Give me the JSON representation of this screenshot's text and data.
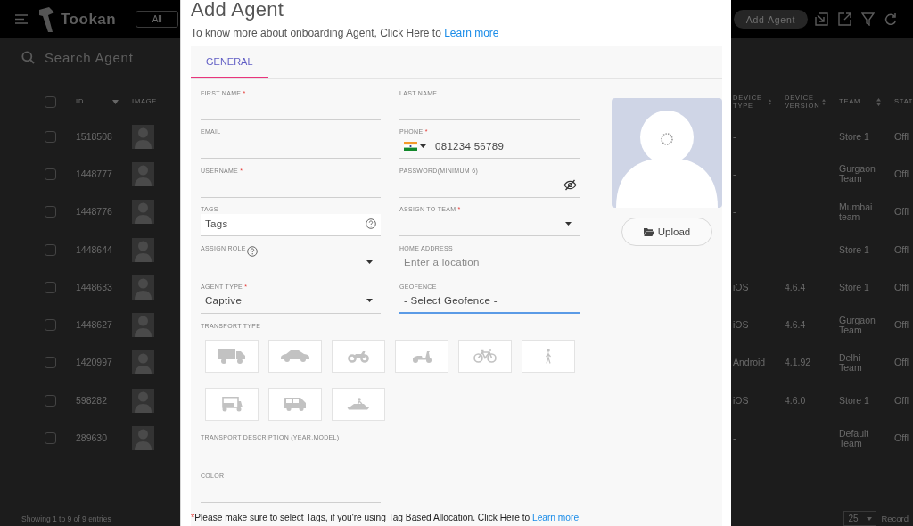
{
  "header": {
    "logo": "Tookan",
    "filter": "All",
    "add_button": "Add Agent"
  },
  "search": {
    "placeholder": "Search Agent"
  },
  "table": {
    "select_all": {
      "checked": false
    },
    "columns": [
      {
        "label": "ID",
        "sortable": true,
        "sorted": true
      },
      {
        "label": "IMAGE",
        "sortable": false
      },
      {
        "label": "DEVICE TYPE",
        "sortable": true,
        "sorted": false
      },
      {
        "label": "DEVICE VERSION",
        "sortable": true,
        "sorted": false
      },
      {
        "label": "TEAM",
        "sortable": true,
        "sorted": false
      },
      {
        "label": "STAT",
        "sortable": false
      }
    ],
    "rows": [
      {
        "checked": false,
        "id": "1518508",
        "device_type": "-",
        "team": "Store 1",
        "status": "Offl"
      },
      {
        "checked": false,
        "id": "1448777",
        "device_type": "-",
        "team": "Gurgaon Team",
        "status": "Offl"
      },
      {
        "checked": false,
        "id": "1448776",
        "device_type": "-",
        "team": "Mumbai team",
        "status": "Offl"
      },
      {
        "checked": false,
        "id": "1448644",
        "device_type": "-",
        "team": "Store 1",
        "status": "Offl"
      },
      {
        "checked": false,
        "id": "1448633",
        "device_type": "iOS",
        "device_version": "4.6.4",
        "team": "Store 1",
        "status": "Offl"
      },
      {
        "checked": false,
        "id": "1448627",
        "device_type": "iOS",
        "device_version": "4.6.4",
        "team": "Gurgaon Team",
        "status": "Offl"
      },
      {
        "checked": false,
        "id": "1420997",
        "device_type": "Android",
        "device_version": "4.1.92",
        "team": "Delhi Team",
        "status": "Offl"
      },
      {
        "checked": false,
        "id": "598282",
        "device_type": "iOS",
        "device_version": "4.6.0",
        "team": "Store 1",
        "status": "Offl"
      },
      {
        "checked": false,
        "id": "289630",
        "device_type": "-",
        "team": "Default Team",
        "status": "Offl"
      }
    ]
  },
  "footer": {
    "info": "Showing 1 to 9 of 9 entries",
    "page_size": "25",
    "page_size_label": "Record"
  },
  "modal": {
    "title": "Add Agent",
    "intro": {
      "text": "To know more about onboarding Agent, Click Here to",
      "link": "Learn more"
    },
    "tabs": [
      {
        "label": "GENERAL",
        "selected": true
      }
    ],
    "fields": [
      {
        "kind": "text",
        "label": "FIRST NAME",
        "marker": "*",
        "help": false,
        "focused": false
      },
      {
        "kind": "text",
        "label": "LAST NAME",
        "help": false,
        "focused": false
      },
      {
        "kind": "text",
        "label": "EMAIL",
        "help": false,
        "focused": false
      },
      {
        "kind": "phone",
        "label": "PHONE",
        "marker": "*",
        "help": false,
        "focused": false,
        "value": "081234 56789"
      },
      {
        "kind": "text",
        "label": "USERNAME",
        "marker": "*",
        "help": false,
        "focused": false
      },
      {
        "kind": "password",
        "label": "PASSWORD(MINIMUM 6)",
        "help": false,
        "focused": false
      },
      {
        "kind": "tags",
        "label": "TAGS",
        "help": false,
        "focused": false,
        "placeholder": "Tags"
      },
      {
        "kind": "select",
        "label": "ASSIGN TO TEAM",
        "marker": "*",
        "help": false,
        "focused": false
      },
      {
        "kind": "select",
        "label": "ASSIGN ROLE",
        "help": true,
        "focused": false
      },
      {
        "kind": "text",
        "label": "HOME ADDRESS",
        "help": false,
        "focused": false,
        "placeholder": "Enter a location"
      },
      {
        "kind": "select",
        "label": "AGENT TYPE",
        "marker": "*",
        "help": false,
        "focused": false,
        "value": "Captive"
      },
      {
        "kind": "text",
        "label": "GEOFENCE",
        "help": false,
        "focused": true,
        "value": "- Select Geofence -"
      }
    ],
    "photo": {
      "loading": true
    },
    "upload_button": "Upload",
    "transport": {
      "label": "TRANSPORT TYPE",
      "options": [
        {
          "kind": "truck",
          "selected": false
        },
        {
          "kind": "car",
          "selected": false
        },
        {
          "kind": "motorcycle",
          "selected": false
        },
        {
          "kind": "scooter",
          "selected": false
        },
        {
          "kind": "bicycle",
          "selected": false
        },
        {
          "kind": "walk",
          "selected": false
        },
        {
          "kind": "rickshaw",
          "selected": false
        },
        {
          "kind": "van",
          "selected": false
        },
        {
          "kind": "jetski",
          "selected": false
        }
      ]
    },
    "more_fields": [
      {
        "kind": "text",
        "label": "TRANSPORT DESCRIPTION (YEAR,MODEL)",
        "help": false,
        "focused": false
      },
      {
        "kind": "text",
        "label": "COLOR",
        "help": false,
        "focused": false
      }
    ],
    "note": {
      "marker": "*",
      "text": "Please make sure to select Tags, if you're using Tag Based Allocation. Click Here to",
      "link": "Learn more"
    }
  }
}
